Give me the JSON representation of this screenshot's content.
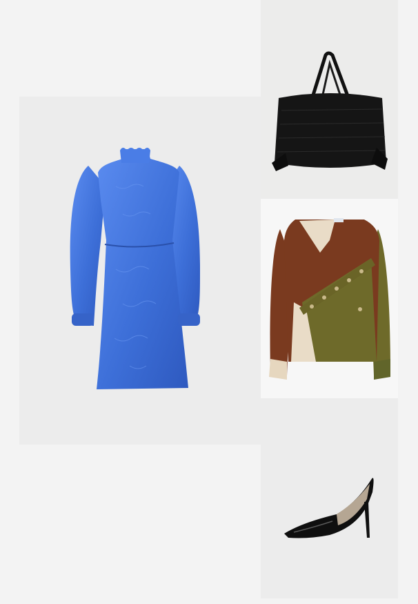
{
  "collage": {
    "items": [
      {
        "id": "dress",
        "icon": "blue-dress-icon",
        "color": "#3f6fd6"
      },
      {
        "id": "bag",
        "icon": "black-tote-bag-icon",
        "color": "#111111"
      },
      {
        "id": "sweater",
        "icon": "colorblock-sweater-icon",
        "colors": [
          "#7a3a1f",
          "#6e6a2a",
          "#e9dcc7"
        ]
      },
      {
        "id": "pump",
        "icon": "black-pump-heel-icon",
        "color": "#0f0f0f"
      }
    ],
    "background": "#f3f3f3",
    "tile_colors": {
      "dress": "#ececec",
      "bag": "#ececeb",
      "sweater": "#f7f7f7",
      "pump": "#ececec"
    }
  }
}
